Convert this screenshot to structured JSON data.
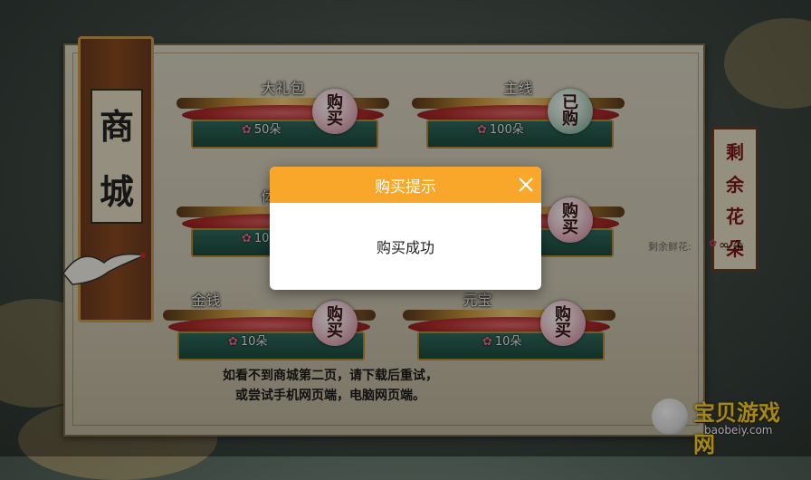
{
  "shop": {
    "title_chars": [
      "商",
      "城"
    ],
    "items": [
      {
        "name": "大礼包",
        "price": "50朵",
        "button": "购买",
        "bought": false
      },
      {
        "name": "主线",
        "price": "100朵",
        "button": "已购",
        "bought": true
      },
      {
        "name": "体魄点",
        "price": "10朵",
        "button": "购买",
        "bought": false
      },
      {
        "name": "",
        "price": "",
        "button": "购买",
        "bought": false
      },
      {
        "name": "金钱",
        "price": "10朵",
        "button": "购买",
        "bought": false
      },
      {
        "name": "元宝",
        "price": "10朵",
        "button": "购买",
        "bought": false
      }
    ],
    "note_line1": "如看不到商城第二页，请下载后重试，",
    "note_line2": "或尝试手机网页端，电脑网页端。"
  },
  "side": {
    "banner_chars": [
      "剩",
      "余",
      "花",
      "朵"
    ],
    "remain_label": "剩余鲜花:",
    "remain_value": "∞",
    "remain_unit": "朵"
  },
  "modal": {
    "title": "购买提示",
    "message": "购买成功"
  },
  "watermark": {
    "text": "宝贝游戏网",
    "url": "baobeiy.com"
  },
  "colors": {
    "modal_header": "#f8a72a",
    "flower": "#e7708a"
  }
}
